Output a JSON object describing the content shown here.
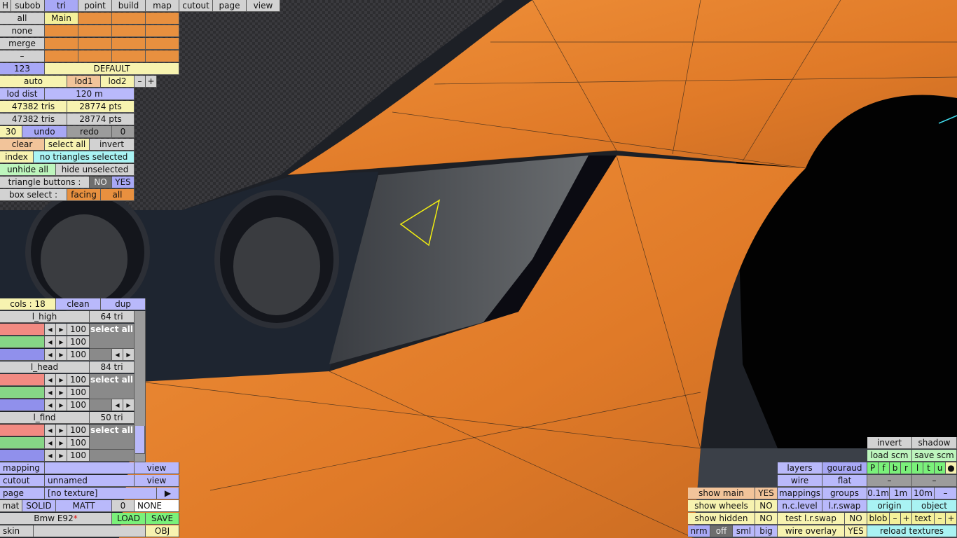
{
  "menu": {
    "h": "H",
    "subob": "subob",
    "tri": "tri",
    "point": "point",
    "build": "build",
    "map": "map",
    "cutout": "cutout",
    "page": "page",
    "view": "view"
  },
  "side": {
    "all": "all",
    "none": "none",
    "merge": "merge",
    "dash": "–",
    "layer_main": "Main",
    "num": "123",
    "default": "DEFAULT"
  },
  "lod": {
    "auto": "auto",
    "lod1": "lod1",
    "lod2": "lod2",
    "minus": "–",
    "plus": "+",
    "dist_label": "lod dist",
    "dist_value": "120 m"
  },
  "stats": {
    "tris1": "47382 tris",
    "pts1": "28774 pts",
    "tris2": "47382 tris",
    "pts2": "28774 pts"
  },
  "undo": {
    "count": "30",
    "undo": "undo",
    "redo": "redo",
    "redo_count": "0"
  },
  "select": {
    "clear": "clear",
    "select_all": "select all",
    "invert": "invert",
    "index": "index",
    "status": "no triangles selected",
    "unhide_all": "unhide all",
    "hide_unselected": "hide unselected",
    "tri_buttons": "triangle buttons :",
    "no": "NO",
    "yes": "YES",
    "box_select": "box select :",
    "facing": "facing",
    "box_all": "all"
  },
  "colors": {
    "header": "cols : 18",
    "clean": "clean",
    "dup": "dup",
    "groups": [
      {
        "name": "l_high",
        "tri": "64 tri",
        "v1": "100",
        "v2": "100",
        "v3": "100",
        "select": "select all"
      },
      {
        "name": "l_head",
        "tri": "84 tri",
        "v1": "100",
        "v2": "100",
        "v3": "100",
        "select": "select all"
      },
      {
        "name": "l_find",
        "tri": "50 tri",
        "v1": "100",
        "v2": "100",
        "v3": "100",
        "select": "select all"
      }
    ]
  },
  "bottom_left": {
    "mapping": "mapping",
    "mapping_view": "view",
    "cutout": "cutout",
    "cutout_value": "unnamed",
    "cutout_view": "view",
    "page": "page",
    "page_value": "[no texture]",
    "page_arrow": "▶",
    "mat": "mat",
    "solid": "SOLID",
    "matt": "MATT",
    "zero": "0",
    "none": "NONE",
    "car_name": "Bmw E92",
    "star": "*",
    "load": "LOAD",
    "save": "SAVE",
    "skin": "skin",
    "obj": "OBJ"
  },
  "bottom_right": {
    "invert": "invert",
    "shadow": "shadow",
    "load_scm": "load scm",
    "save_scm": "save scm",
    "layers": "layers",
    "gouraud": "gouraud",
    "flags": [
      "P",
      "f",
      "b",
      "r",
      "l",
      "t",
      "u"
    ],
    "dot": "●",
    "wire": "wire",
    "flat": "flat",
    "dash1": "–",
    "dash2": "–",
    "mappings": "mappings",
    "groups": "groups",
    "g1": "0.1m",
    "g2": "1m",
    "g3": "10m",
    "g4": "–",
    "show_main": "show main",
    "show_main_v": "YES",
    "show_wheels": "show wheels",
    "show_wheels_v": "NO",
    "show_hidden": "show hidden",
    "show_hidden_v": "NO",
    "nclevel": "n.c.level",
    "lrswap": "l.r.swap",
    "origin": "origin",
    "object": "object",
    "test_lrswap": "test l.r.swap",
    "test_v": "NO",
    "blob": "blob",
    "text": "text",
    "minus": "–",
    "plus": "+",
    "nrm": "nrm",
    "off": "off",
    "sml": "sml",
    "big": "big",
    "wire_overlay": "wire overlay",
    "wire_overlay_v": "YES",
    "reload": "reload textures"
  }
}
